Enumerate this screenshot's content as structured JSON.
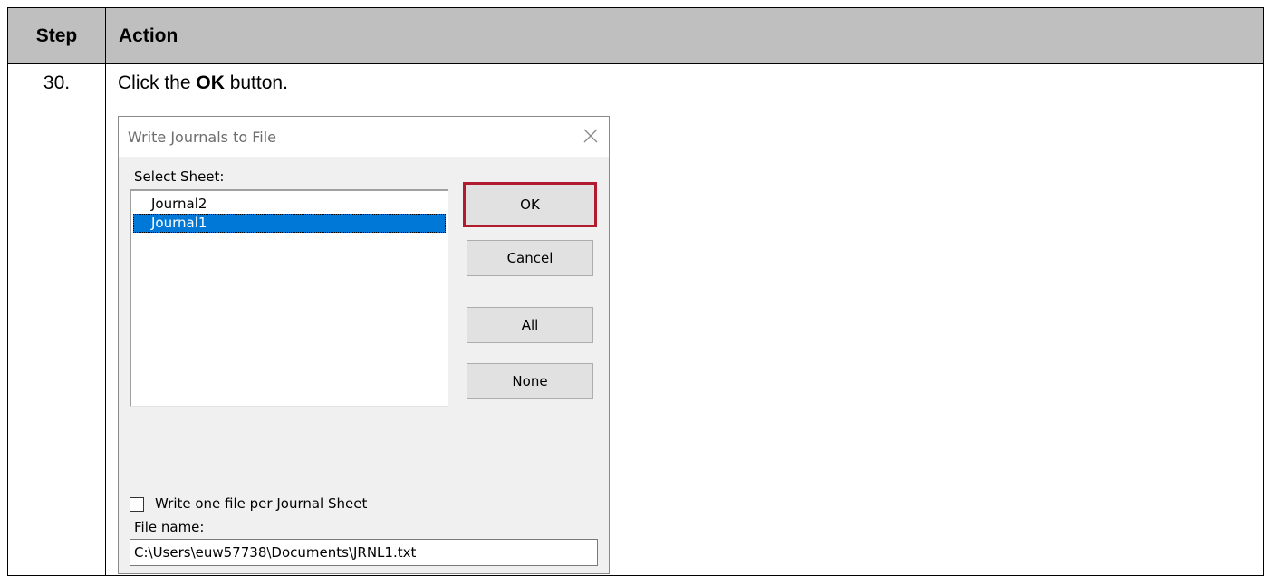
{
  "table": {
    "header_step": "Step",
    "header_action": "Action",
    "step_number": "30.",
    "instruction_prefix": "Click the ",
    "instruction_bold": "OK",
    "instruction_suffix": " button."
  },
  "dialog": {
    "title": "Write Journals to File",
    "close_icon": "close-icon",
    "select_sheet_label": "Select Sheet:",
    "sheets": [
      {
        "label": "Journal2",
        "selected": false
      },
      {
        "label": "Journal1",
        "selected": true
      }
    ],
    "buttons": {
      "ok": "OK",
      "cancel": "Cancel",
      "all": "All",
      "none": "None"
    },
    "checkbox_label": "Write one file per Journal Sheet",
    "checkbox_checked": false,
    "file_name_label": "File name:",
    "file_name_value": "C:\\Users\\euw57738\\Documents\\JRNL1.txt",
    "highlight_color": "#b01c2e",
    "selection_color": "#0078d7"
  }
}
